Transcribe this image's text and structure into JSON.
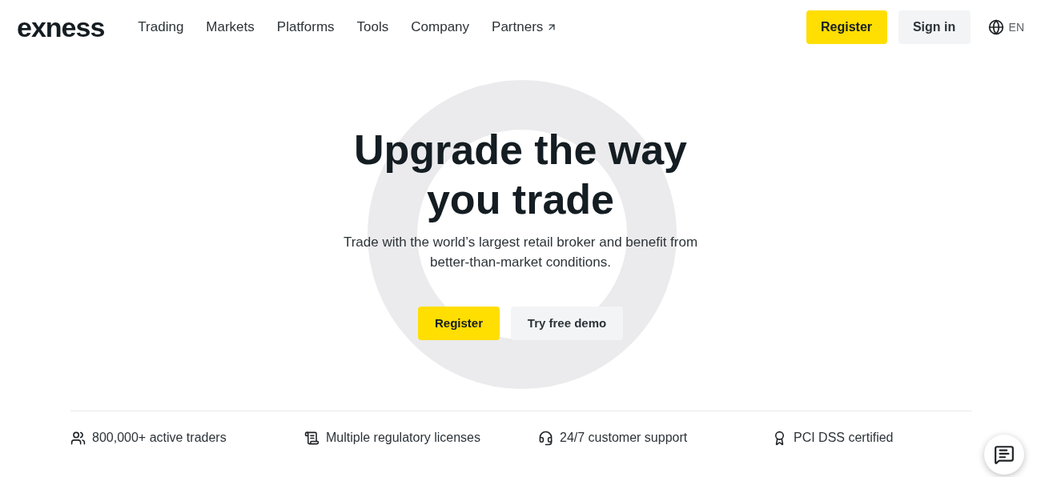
{
  "header": {
    "logo": "exness",
    "nav": [
      {
        "label": "Trading",
        "external": false
      },
      {
        "label": "Markets",
        "external": false
      },
      {
        "label": "Platforms",
        "external": false
      },
      {
        "label": "Tools",
        "external": false
      },
      {
        "label": "Company",
        "external": false
      },
      {
        "label": "Partners",
        "external": true
      }
    ],
    "register": "Register",
    "sign_in": "Sign in",
    "language": "EN"
  },
  "hero": {
    "title_lines": [
      "Upgrade the way",
      "you trade"
    ],
    "subtitle_lines": [
      "Trade with the world’s largest retail broker and benefit from",
      "better-than-market conditions."
    ],
    "primary_button": "Register",
    "secondary_button": "Try free demo"
  },
  "features": [
    {
      "kind": "people",
      "label": "800,000+ active traders"
    },
    {
      "kind": "document",
      "label": "Multiple regulatory licenses"
    },
    {
      "kind": "support",
      "label": "24/7 customer support"
    },
    {
      "kind": "certificate",
      "label": "PCI DSS certified"
    }
  ]
}
